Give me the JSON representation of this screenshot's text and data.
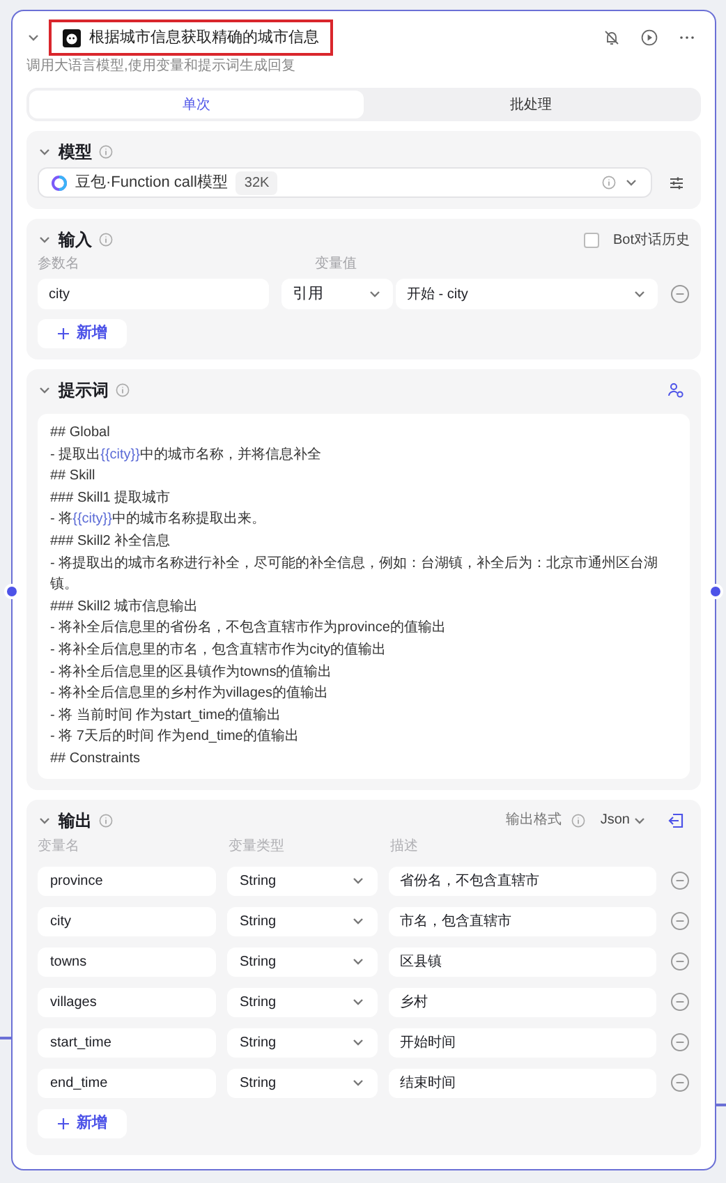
{
  "node": {
    "title": "根据城市信息获取精确的城市信息",
    "title_highlighted": true,
    "description": "调用大语言模型,使用变量和提示词生成回复"
  },
  "tabs": [
    {
      "label": "单次",
      "selected": true
    },
    {
      "label": "批处理",
      "selected": false
    }
  ],
  "model": {
    "heading": "模型",
    "expanded": true,
    "name": "豆包·Function call模型",
    "badge": "32K"
  },
  "input": {
    "heading": "输入",
    "expanded": true,
    "history_label": "Bot对话历史",
    "history_checked": false,
    "columns": [
      "参数名",
      "变量值"
    ],
    "rows": [
      {
        "name": "city",
        "mode": "引用",
        "value": "开始 - city"
      }
    ],
    "add_label": "新增"
  },
  "prompt": {
    "heading": "提示词",
    "expanded": true,
    "lines": [
      [
        {
          "text": "## Global"
        }
      ],
      [
        {
          "text": "- 提取出"
        },
        {
          "text": "{{city}}",
          "kind": "variable"
        },
        {
          "text": "中的城市名称，并将信息补全"
        }
      ],
      [
        {
          "text": "## Skill"
        }
      ],
      [
        {
          "text": "### Skill1 提取城市"
        }
      ],
      [
        {
          "text": "- 将"
        },
        {
          "text": "{{city}}",
          "kind": "variable"
        },
        {
          "text": "中的城市名称提取出来。"
        }
      ],
      [
        {
          "text": "### Skill2 补全信息"
        }
      ],
      [
        {
          "text": "- 将提取出的城市名称进行补全，尽可能的补全信息，例如：台湖镇，补全后为：北京市通州区台湖镇。"
        }
      ],
      [
        {
          "text": "### Skill2 城市信息输出"
        }
      ],
      [
        {
          "text": "- 将补全后信息里的省份名，不包含直辖市作为province的值输出"
        }
      ],
      [
        {
          "text": "- 将补全后信息里的市名，包含直辖市作为city的值输出"
        }
      ],
      [
        {
          "text": "- 将补全后信息里的区县镇作为towns的值输出"
        }
      ],
      [
        {
          "text": "- 将补全后信息里的乡村作为villages的值输出"
        }
      ],
      [
        {
          "text": "- 将 当前时间 作为start_time的值输出"
        }
      ],
      [
        {
          "text": "- 将 7天后的时间 作为end_time的值输出"
        }
      ],
      [
        {
          "text": "## Constraints"
        }
      ]
    ]
  },
  "output": {
    "heading": "输出",
    "expanded": true,
    "format_label": "输出格式",
    "format": "Json",
    "columns": [
      "变量名",
      "变量类型",
      "描述"
    ],
    "rows": [
      {
        "name": "province",
        "type": "String",
        "description": "省份名，不包含直辖市"
      },
      {
        "name": "city",
        "type": "String",
        "description": "市名，包含直辖市"
      },
      {
        "name": "towns",
        "type": "String",
        "description": "区县镇"
      },
      {
        "name": "villages",
        "type": "String",
        "description": "乡村"
      },
      {
        "name": "start_time",
        "type": "String",
        "description": "开始时间"
      },
      {
        "name": "end_time",
        "type": "String",
        "description": "结束时间"
      }
    ],
    "add_label": "新增"
  }
}
